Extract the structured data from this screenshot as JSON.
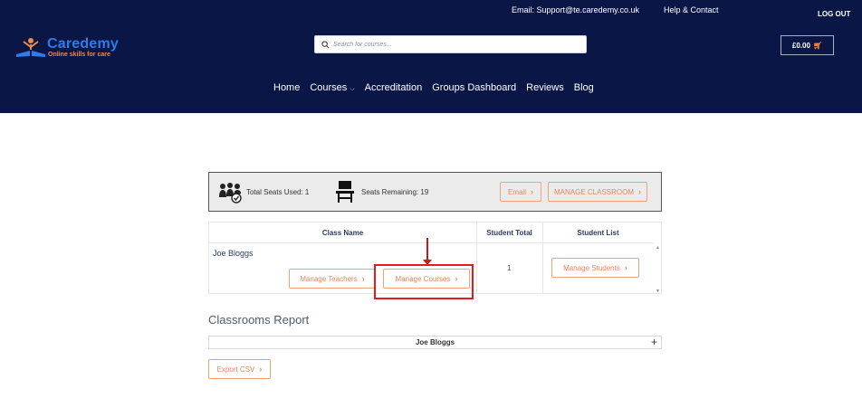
{
  "topbar": {
    "email": "Email: Support@te.caredemy.co.uk",
    "help": "Help & Contact",
    "logout": "LOG OUT"
  },
  "brand": {
    "name": "Caredemy",
    "tagline": "Online skills for care",
    "colors": {
      "name": "#2f7ce8",
      "tagline": "#f08a4b",
      "header_bg": "#0a1746"
    }
  },
  "search": {
    "placeholder": "Search for courses..."
  },
  "cart": {
    "amount": "£0.00",
    "icon": "basket-icon"
  },
  "nav": {
    "items": [
      "Home",
      "Courses",
      "Accreditation",
      "Groups Dashboard",
      "Reviews",
      "Blog"
    ]
  },
  "seats": {
    "used_label": "Total Seats Used: 1",
    "remaining_label": "Seats Remaining: 19",
    "email_button": "Email",
    "manage_classroom_button": "MANAGE CLASSROOM"
  },
  "class_table": {
    "headers": [
      "Class Name",
      "Student Total",
      "Student List"
    ],
    "rows": [
      {
        "class_name": "Joe Bloggs",
        "manage_teachers": "Manage Teachers",
        "manage_courses": "Manage Courses",
        "student_total": "1",
        "manage_students": "Manage Students"
      }
    ]
  },
  "report": {
    "title": "Classrooms Report",
    "row_label": "Joe Bloggs",
    "export_button": "Export CSV"
  },
  "accent_colors": {
    "button_border": "#f0a27a",
    "button_text": "#e9865a",
    "highlight": "#e31b1b"
  }
}
